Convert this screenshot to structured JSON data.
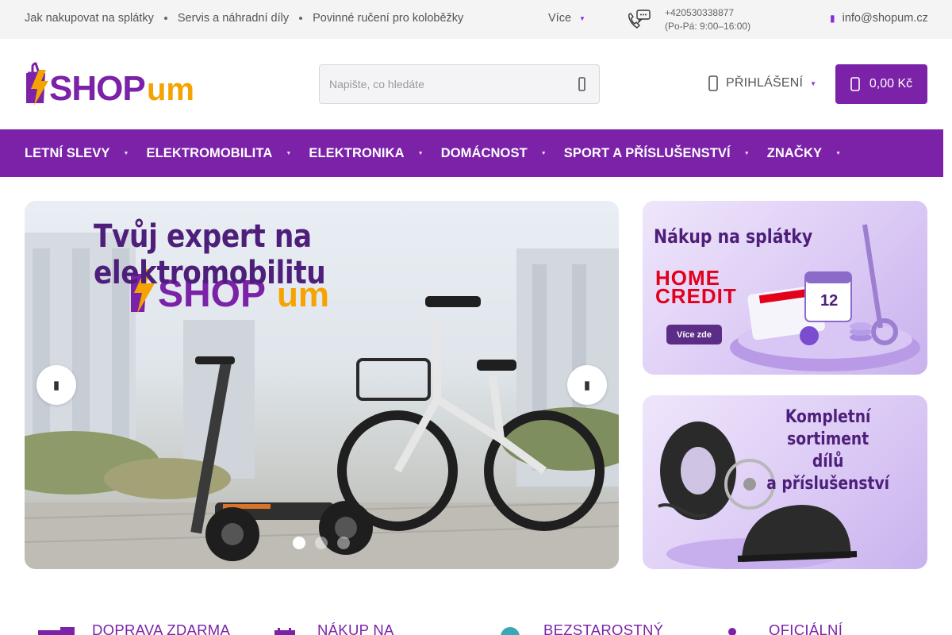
{
  "topbar": {
    "links": [
      "Jak nakupovat na splátky",
      "Servis a náhradní díly",
      "Povinné ručení pro koloběžky"
    ],
    "more": "Více",
    "phone": "+420530338877",
    "hours": "(Po-Pá: 9:00–16:00)",
    "email": "info@shopum.cz"
  },
  "header": {
    "logo": {
      "text_left": "SHOP",
      "text_right": "um"
    },
    "search_placeholder": "Napište, co hledáte",
    "login": "PŘIHLÁŠENÍ",
    "cart_total": "0,00 Kč"
  },
  "nav": {
    "items": [
      "LETNÍ SLEVY",
      "ELEKTROMOBILITA",
      "ELEKTRONIKA",
      "DOMÁCNOST",
      "SPORT A PŘÍSLUŠENSTVÍ",
      "ZNAČKY"
    ]
  },
  "hero": {
    "headline": "Tvůj expert na elektromobilitu",
    "logo_left": "SHOP",
    "logo_right": "um",
    "slide_count": 3,
    "active_slide": 1
  },
  "banners": [
    {
      "title": "Nákup na splátky",
      "brand": [
        "HOME",
        "CREDIT"
      ],
      "button": "Více zde"
    },
    {
      "title_lines": [
        "Kompletní sortiment",
        "dílů",
        "a příslušenství"
      ]
    }
  ],
  "features": [
    "DOPRAVA ZDARMA",
    "NÁKUP NA",
    "BEZSTAROSTNÝ",
    "OFICIÁLNÍ"
  ],
  "colors": {
    "brand_purple": "#7b22a8",
    "accent_orange": "#f5a300",
    "homecredit_red": "#e3001b"
  }
}
